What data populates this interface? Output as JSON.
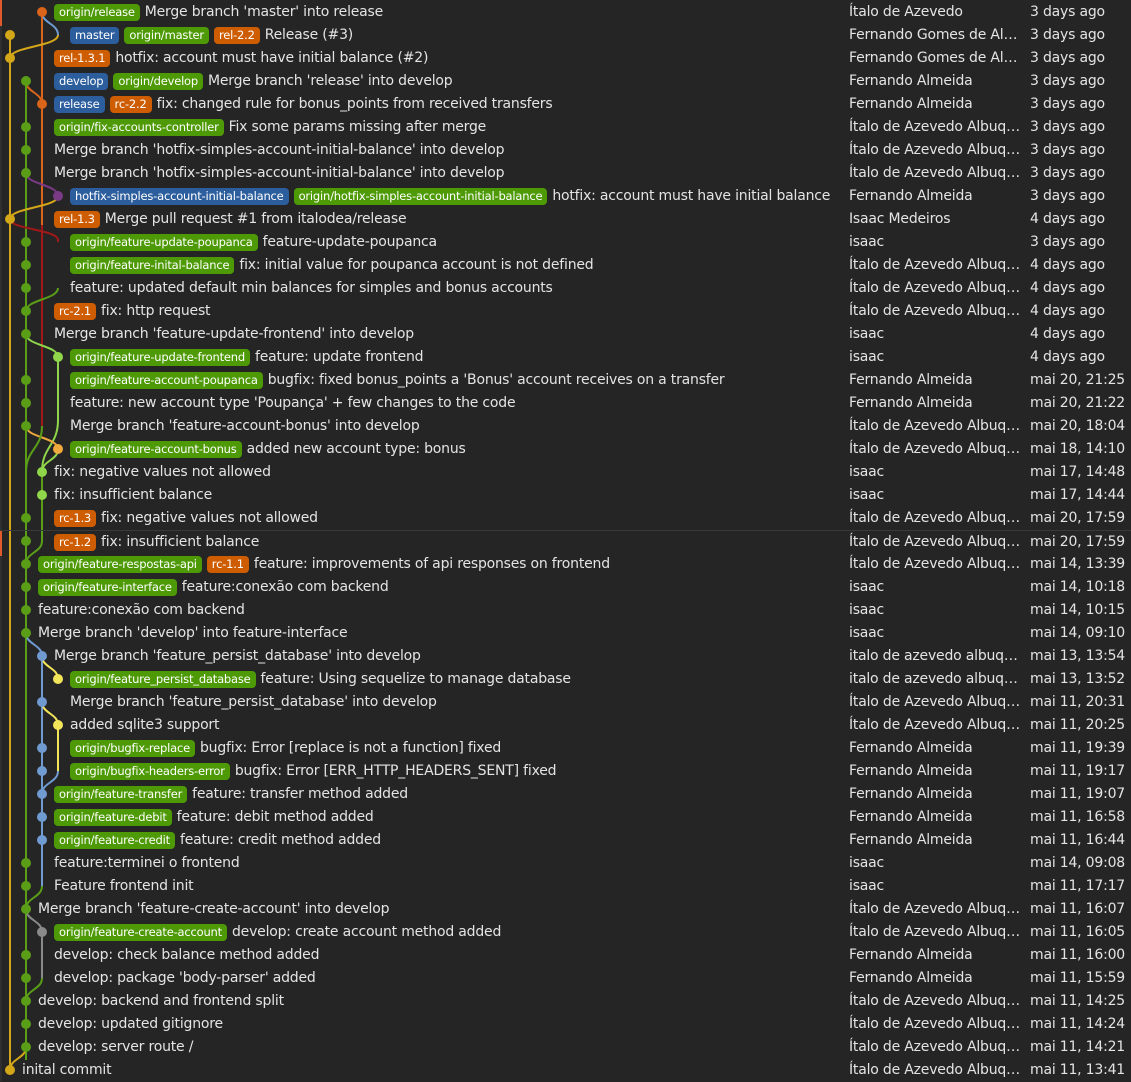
{
  "app": {
    "view": "git-commit-graph"
  },
  "colors": {
    "background": "#252526",
    "text": "#e4e4e4",
    "badge_local": "#2c5e9e",
    "badge_remote": "#4e9a06",
    "badge_tag": "#ce5c00",
    "lane_yellow": "#d4a719",
    "lane_green": "#5a9e17",
    "lane_orange": "#d9641a",
    "lane_red": "#a01818",
    "lane_purple": "#7a3a86",
    "lane_lime": "#8fd64a",
    "lane_lightorange": "#f0a93d",
    "lane_blue": "#6f9bd1",
    "lane_lightyellow": "#f3e55a",
    "lane_gray": "#8a8a8a"
  },
  "commits": [
    {
      "refs": [
        {
          "name": "origin/release",
          "type": "remote"
        }
      ],
      "message": "Merge branch 'master' into release",
      "author": "Ítalo de Azevedo",
      "date": "3 days ago"
    },
    {
      "refs": [
        {
          "name": "master",
          "type": "local"
        },
        {
          "name": "origin/master",
          "type": "remote"
        },
        {
          "name": "rel-2.2",
          "type": "tag"
        }
      ],
      "message": "Release (#3)",
      "author": "Fernando Gomes de Al…",
      "date": "3 days ago"
    },
    {
      "refs": [
        {
          "name": "rel-1.3.1",
          "type": "tag"
        }
      ],
      "message": "hotfix: account must have initial balance (#2)",
      "author": "Fernando Gomes de Al…",
      "date": "3 days ago"
    },
    {
      "refs": [
        {
          "name": "develop",
          "type": "local"
        },
        {
          "name": "origin/develop",
          "type": "remote"
        }
      ],
      "message": "Merge branch 'release' into develop",
      "author": "Fernando Almeida",
      "date": "3 days ago"
    },
    {
      "refs": [
        {
          "name": "release",
          "type": "local"
        },
        {
          "name": "rc-2.2",
          "type": "tag"
        }
      ],
      "message": "fix: changed rule for bonus_points from received transfers",
      "author": "Fernando Almeida",
      "date": "3 days ago"
    },
    {
      "refs": [
        {
          "name": "origin/fix-accounts-controller",
          "type": "remote"
        }
      ],
      "message": "Fix some params missing after merge",
      "author": "Ítalo de Azevedo Albuq…",
      "date": "3 days ago"
    },
    {
      "refs": [],
      "message": "Merge branch 'hotfix-simples-account-initial-balance' into develop",
      "author": "Ítalo de Azevedo Albuq…",
      "date": "3 days ago"
    },
    {
      "refs": [],
      "message": "Merge branch 'hotfix-simples-account-initial-balance' into develop",
      "author": "Ítalo de Azevedo Albuq…",
      "date": "3 days ago"
    },
    {
      "refs": [
        {
          "name": "hotfix-simples-account-initial-balance",
          "type": "local"
        },
        {
          "name": "origin/hotfix-simples-account-initial-balance",
          "type": "remote"
        }
      ],
      "message": "hotfix: account must have initial balance",
      "author": "Fernando Almeida",
      "date": "3 days ago"
    },
    {
      "refs": [
        {
          "name": "rel-1.3",
          "type": "tag"
        }
      ],
      "message": "Merge pull request #1 from italodea/release",
      "author": "Isaac Medeiros",
      "date": "4 days ago"
    },
    {
      "refs": [
        {
          "name": "origin/feature-update-poupanca",
          "type": "remote"
        }
      ],
      "message": "feature-update-poupanca",
      "author": "isaac",
      "date": "3 days ago"
    },
    {
      "refs": [
        {
          "name": "origin/feature-inital-balance",
          "type": "remote"
        }
      ],
      "message": "fix: initial value for poupanca account is not defined",
      "author": "Ítalo de Azevedo Albuq…",
      "date": "4 days ago"
    },
    {
      "refs": [],
      "message": "feature: updated default min balances for simples and bonus accounts",
      "author": "Ítalo de Azevedo Albuq…",
      "date": "4 days ago"
    },
    {
      "refs": [
        {
          "name": "rc-2.1",
          "type": "tag"
        }
      ],
      "message": "fix: http request",
      "author": "Ítalo de Azevedo Albuq…",
      "date": "4 days ago"
    },
    {
      "refs": [],
      "message": "Merge branch 'feature-update-frontend' into develop",
      "author": "isaac",
      "date": "4 days ago"
    },
    {
      "refs": [
        {
          "name": "origin/feature-update-frontend",
          "type": "remote"
        }
      ],
      "message": "feature: update frontend",
      "author": "isaac",
      "date": "4 days ago"
    },
    {
      "refs": [
        {
          "name": "origin/feature-account-poupanca",
          "type": "remote"
        }
      ],
      "message": "bugfix: fixed bonus_points a 'Bonus' account receives on a transfer",
      "author": "Fernando Almeida",
      "date": "mai 20, 21:25"
    },
    {
      "refs": [],
      "message": "feature: new account type 'Poupança' + few changes to the code",
      "author": "Fernando Almeida",
      "date": "mai 20, 21:22"
    },
    {
      "refs": [],
      "message": "Merge branch 'feature-account-bonus' into develop",
      "author": "Ítalo de Azevedo Albuq…",
      "date": "mai 20, 18:04"
    },
    {
      "refs": [
        {
          "name": "origin/feature-account-bonus",
          "type": "remote"
        }
      ],
      "message": "added new account type: bonus",
      "author": "Ítalo de Azevedo Albuq…",
      "date": "mai 18, 14:10"
    },
    {
      "refs": [],
      "message": "fix: negative values not allowed",
      "author": "isaac",
      "date": "mai 17, 14:48"
    },
    {
      "refs": [],
      "message": "fix: insufficient balance",
      "author": "isaac",
      "date": "mai 17, 14:44"
    },
    {
      "refs": [
        {
          "name": "rc-1.3",
          "type": "tag"
        }
      ],
      "message": "fix: negative values not allowed",
      "author": "Ítalo de Azevedo Albuq…",
      "date": "mai 20, 17:59"
    },
    {
      "refs": [
        {
          "name": "rc-1.2",
          "type": "tag"
        }
      ],
      "message": "fix: insufficient balance",
      "author": "Ítalo de Azevedo Albuq…",
      "date": "mai 20, 17:59"
    },
    {
      "refs": [
        {
          "name": "origin/feature-respostas-api",
          "type": "remote"
        },
        {
          "name": "rc-1.1",
          "type": "tag"
        }
      ],
      "message": "feature: improvements of api responses on frontend",
      "author": "Ítalo de Azevedo Albuq…",
      "date": "mai 14, 13:39"
    },
    {
      "refs": [
        {
          "name": "origin/feature-interface",
          "type": "remote"
        }
      ],
      "message": "feature:conexão com backend",
      "author": "isaac",
      "date": "mai 14, 10:18"
    },
    {
      "refs": [],
      "message": "feature:conexão com backend",
      "author": "isaac",
      "date": "mai 14, 10:15"
    },
    {
      "refs": [],
      "message": "Merge branch 'develop' into feature-interface",
      "author": "isaac",
      "date": "mai 14, 09:10"
    },
    {
      "refs": [],
      "message": "Merge branch 'feature_persist_database' into develop",
      "author": "italo de azevedo albuq…",
      "date": "mai 13, 13:54"
    },
    {
      "refs": [
        {
          "name": "origin/feature_persist_database",
          "type": "remote"
        }
      ],
      "message": "feature: Using sequelize to manage database",
      "author": "italo de azevedo albuq…",
      "date": "mai 13, 13:52"
    },
    {
      "refs": [],
      "message": "Merge branch 'feature_persist_database' into develop",
      "author": "Ítalo de Azevedo Albuq…",
      "date": "mai 11, 20:31"
    },
    {
      "refs": [],
      "message": "added sqlite3 support",
      "author": "Ítalo de Azevedo Albuq…",
      "date": "mai 11, 20:25"
    },
    {
      "refs": [
        {
          "name": "origin/bugfix-replace",
          "type": "remote"
        }
      ],
      "message": "bugfix: Error [replace is not a function] fixed",
      "author": "Fernando Almeida",
      "date": "mai 11, 19:39"
    },
    {
      "refs": [
        {
          "name": "origin/bugfix-headers-error",
          "type": "remote"
        }
      ],
      "message": "bugfix: Error [ERR_HTTP_HEADERS_SENT] fixed",
      "author": "Fernando Almeida",
      "date": "mai 11, 19:17"
    },
    {
      "refs": [
        {
          "name": "origin/feature-transfer",
          "type": "remote"
        }
      ],
      "message": "feature: transfer method added",
      "author": "Fernando Almeida",
      "date": "mai 11, 19:07"
    },
    {
      "refs": [
        {
          "name": "origin/feature-debit",
          "type": "remote"
        }
      ],
      "message": "feature: debit method added",
      "author": "Fernando Almeida",
      "date": "mai 11, 16:58"
    },
    {
      "refs": [
        {
          "name": "origin/feature-credit",
          "type": "remote"
        }
      ],
      "message": "feature: credit method added",
      "author": "Fernando Almeida",
      "date": "mai 11, 16:44"
    },
    {
      "refs": [],
      "message": "feature:terminei o frontend",
      "author": "isaac",
      "date": "mai 14, 09:08"
    },
    {
      "refs": [],
      "message": "Feature frontend init",
      "author": "isaac",
      "date": "mai 11, 17:17"
    },
    {
      "refs": [],
      "message": "Merge branch 'feature-create-account' into develop",
      "author": "Ítalo de Azevedo Albuq…",
      "date": "mai 11, 16:07"
    },
    {
      "refs": [
        {
          "name": "origin/feature-create-account",
          "type": "remote"
        }
      ],
      "message": "develop: create account method added",
      "author": "Ítalo de Azevedo Albuq…",
      "date": "mai 11, 16:05"
    },
    {
      "refs": [],
      "message": "develop: check balance method added",
      "author": "Fernando Almeida",
      "date": "mai 11, 16:00"
    },
    {
      "refs": [],
      "message": "develop: package 'body-parser' added",
      "author": "Fernando Almeida",
      "date": "mai 11, 15:59"
    },
    {
      "refs": [],
      "message": "develop: backend and frontend split",
      "author": "Ítalo de Azevedo Albuq…",
      "date": "mai 11, 14:25"
    },
    {
      "refs": [],
      "message": "develop: updated gitignore",
      "author": "Ítalo de Azevedo Albuq…",
      "date": "mai 11, 14:24"
    },
    {
      "refs": [],
      "message": "develop: server route /",
      "author": "Ítalo de Azevedo Albuq…",
      "date": "mai 11, 14:21"
    },
    {
      "refs": [],
      "message": "inital commit",
      "author": "Ítalo de Azevedo Albuq…",
      "date": "mai 11, 13:41"
    }
  ]
}
